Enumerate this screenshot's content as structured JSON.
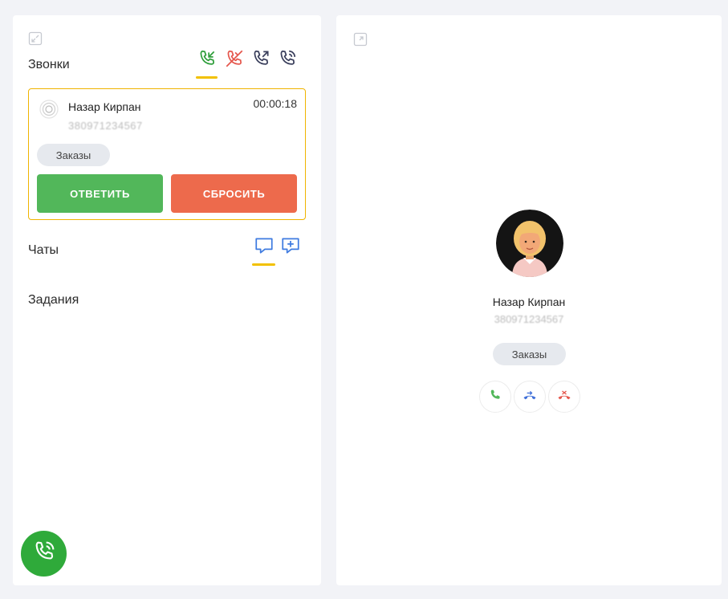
{
  "left_panel": {
    "calls_title": "Звонки",
    "chats_title": "Чаты",
    "tasks_title": "Задания"
  },
  "call_card": {
    "caller_name": "Назар Кирпан",
    "caller_phone": "380971234567",
    "timer": "00:00:18",
    "tag": "Заказы",
    "answer_label": "ОТВЕТИТЬ",
    "reject_label": "СБРОСИТЬ"
  },
  "right_panel": {
    "caller_name": "Назар Кирпан",
    "caller_phone": "380971234567",
    "tag": "Заказы"
  },
  "colors": {
    "accent_underline": "#f2c100",
    "answer": "#52b75a",
    "reject": "#ed6a4c",
    "card_border": "#f0b400",
    "fab": "#2faa3a"
  },
  "icons": {
    "calls_tabs": [
      "phone-incoming-icon",
      "phone-missed-icon",
      "phone-outgoing-icon",
      "phone-all-icon"
    ],
    "chats_tabs": [
      "chat-bubble-icon",
      "chat-add-icon"
    ],
    "call_actions": [
      "accept-call-icon",
      "transfer-call-icon",
      "hangup-call-icon"
    ]
  }
}
